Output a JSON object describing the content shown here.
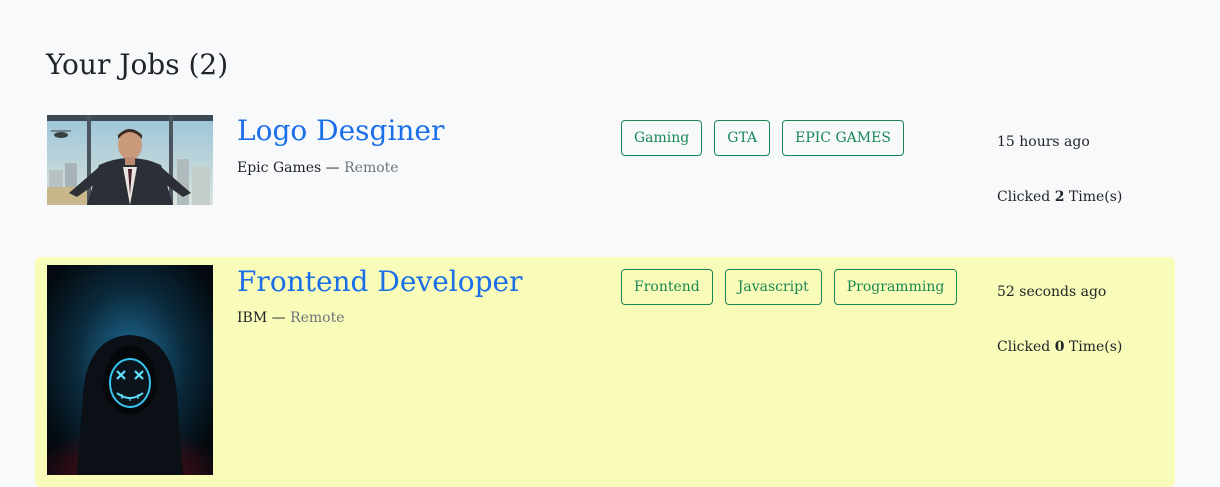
{
  "page": {
    "title": "Your Jobs (2)"
  },
  "jobs": [
    {
      "title": "Logo Desginer",
      "company": "Epic Games",
      "separator": " — ",
      "location": "Remote",
      "tags": [
        "Gaming",
        "GTA",
        "EPIC GAMES"
      ],
      "posted": "15 hours ago",
      "clicks_prefix": "Clicked ",
      "clicks_count": "2",
      "clicks_suffix": " Time(s)",
      "highlighted": false,
      "image": "man-in-suit-city-thumbnail"
    },
    {
      "title": "Frontend Developer",
      "company": "IBM",
      "separator": " — ",
      "location": "Remote",
      "tags": [
        "Frontend",
        "Javascript",
        "Programming"
      ],
      "posted": "52 seconds ago",
      "clicks_prefix": "Clicked ",
      "clicks_count": "0",
      "clicks_suffix": " Time(s)",
      "highlighted": true,
      "image": "hooded-figure-neon-mask-thumbnail"
    }
  ],
  "colors": {
    "background": "#f8f9fb",
    "title_link": "#1a6fe8",
    "tag": "#198754",
    "highlight": "#f9fbb8",
    "muted": "#6c757d"
  }
}
